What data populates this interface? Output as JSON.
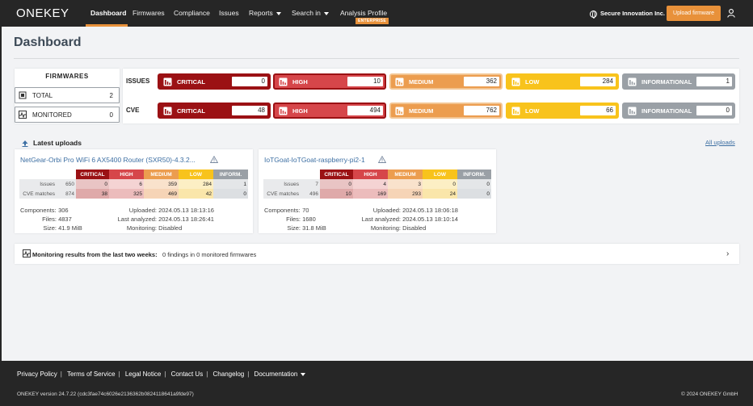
{
  "nav": {
    "logo": "ONEKEY",
    "items": [
      {
        "label": "Dashboard"
      },
      {
        "label": "Firmwares"
      },
      {
        "label": "Compliance"
      },
      {
        "label": "Issues"
      },
      {
        "label": "Reports"
      },
      {
        "label": "Search in"
      },
      {
        "label": "Analysis Profile"
      }
    ],
    "enterprise_badge": "ENTERPRISE",
    "org": "Secure Innovation Inc.",
    "upload_button": "Upload firmware",
    "accent": "#e8913a"
  },
  "page": {
    "title": "Dashboard"
  },
  "firmwares": {
    "title": "FIRMWARES",
    "total_label": "TOTAL",
    "total_value": "2",
    "monitored_label": "MONITORED",
    "monitored_value": "0"
  },
  "issues": {
    "label": "ISSUES",
    "critical": {
      "name": "CRITICAL",
      "value": "0"
    },
    "high": {
      "name": "HIGH",
      "value": "10"
    },
    "medium": {
      "name": "MEDIUM",
      "value": "362"
    },
    "low": {
      "name": "LOW",
      "value": "284"
    },
    "informational": {
      "name": "INFORMATIONAL",
      "value": "1"
    }
  },
  "cve": {
    "label": "CVE",
    "critical": {
      "name": "CRITICAL",
      "value": "48"
    },
    "high": {
      "name": "HIGH",
      "value": "494"
    },
    "medium": {
      "name": "MEDIUM",
      "value": "762"
    },
    "low": {
      "name": "LOW",
      "value": "66"
    },
    "informational": {
      "name": "INFORMATIONAL",
      "value": "0"
    }
  },
  "severity_colors": {
    "critical": "#9b1114",
    "high": "#d6464a",
    "medium": "#ec9d4f",
    "low": "#f8c31c",
    "informational": "#9aa0a6"
  },
  "latest_uploads": {
    "title": "Latest uploads",
    "all_link": "All uploads",
    "headers": [
      "CRITICAL",
      "HIGH",
      "MEDIUM",
      "LOW",
      "INFORM."
    ],
    "cards": [
      {
        "name": "NetGear-Orbi Pro WiFi 6 AX5400 Router (SXR50)-4.3.2...",
        "issues_label": "Issues",
        "issues_total": "650",
        "issues": [
          "0",
          "6",
          "359",
          "284",
          "1"
        ],
        "cve_label": "CVE matches",
        "cve_total": "874",
        "cve": [
          "38",
          "325",
          "469",
          "42",
          "0"
        ],
        "components_label": "Components:",
        "components": "306",
        "files_label": "Files:",
        "files": "4837",
        "size_label": "Size:",
        "size": "41.9 MiB",
        "uploaded_label": "Uploaded:",
        "uploaded": "2024.05.13 18:13:16",
        "analyzed_label": "Last analyzed:",
        "analyzed": "2024.05.13 18:26:41",
        "monitoring_label": "Monitoring:",
        "monitoring": "Disabled"
      },
      {
        "name": "IoTGoat-IoTGoat-raspberry-pi2-1",
        "issues_label": "Issues",
        "issues_total": "7",
        "issues": [
          "0",
          "4",
          "3",
          "0",
          "0"
        ],
        "cve_label": "CVE matches",
        "cve_total": "496",
        "cve": [
          "10",
          "169",
          "293",
          "24",
          "0"
        ],
        "components_label": "Components:",
        "components": "70",
        "files_label": "Files:",
        "files": "1680",
        "size_label": "Size:",
        "size": "31.8 MiB",
        "uploaded_label": "Uploaded:",
        "uploaded": "2024.05.13 18:06:18",
        "analyzed_label": "Last analyzed:",
        "analyzed": "2024.05.13 18:10:14",
        "monitoring_label": "Monitoring:",
        "monitoring": "Disabled"
      }
    ]
  },
  "monitoring": {
    "label": "Monitoring results from the last two weeks:",
    "value": "0 findings in 0 monitored firmwares"
  },
  "footer": {
    "links": [
      "Privacy Policy",
      "Terms of Service",
      "Legal Notice",
      "Contact Us",
      "Changelog",
      "Documentation"
    ],
    "version": "ONEKEY version 24.7.22 (cdc3fae74c6026e2136362b0824118641a9fde97)",
    "copyright": "© 2024 ONEKEY GmbH"
  }
}
